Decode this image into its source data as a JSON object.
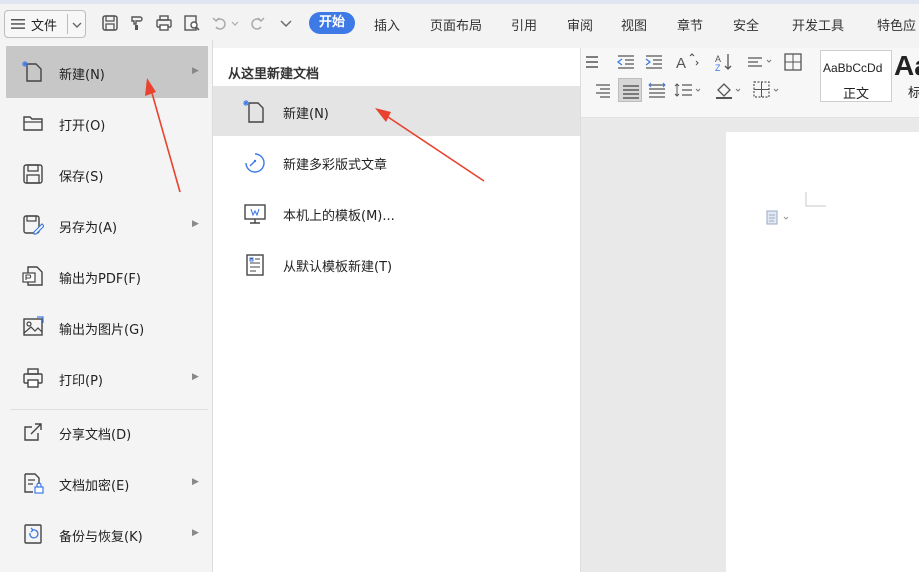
{
  "toolbar": {
    "file_label": "文件",
    "tabs": [
      "开始",
      "插入",
      "页面布局",
      "引用",
      "审阅",
      "视图",
      "章节",
      "安全",
      "开发工具",
      "特色应"
    ]
  },
  "ribbon": {
    "style_sample": "AaBbCcDd",
    "style_name": "正文",
    "style_big_sample": "Aa",
    "style_big_name": "标"
  },
  "file_menu": {
    "items": [
      {
        "label": "新建(N)",
        "icon": "new-doc-icon",
        "has_submenu": true
      },
      {
        "label": "打开(O)",
        "icon": "folder-icon",
        "has_submenu": false
      },
      {
        "label": "保存(S)",
        "icon": "save-icon",
        "has_submenu": false
      },
      {
        "label": "另存为(A)",
        "icon": "save-as-icon",
        "has_submenu": true
      },
      {
        "label": "输出为PDF(F)",
        "icon": "pdf-export-icon",
        "has_submenu": false
      },
      {
        "label": "输出为图片(G)",
        "icon": "image-export-icon",
        "has_submenu": false
      },
      {
        "label": "打印(P)",
        "icon": "print-icon",
        "has_submenu": true
      },
      {
        "label": "分享文档(D)",
        "icon": "share-icon",
        "has_submenu": false
      },
      {
        "label": "文档加密(E)",
        "icon": "encrypt-icon",
        "has_submenu": true
      },
      {
        "label": "备份与恢复(K)",
        "icon": "backup-icon",
        "has_submenu": true
      }
    ]
  },
  "submenu": {
    "header": "从这里新建文档",
    "items": [
      {
        "label": "新建(N)",
        "icon": "new-doc-icon"
      },
      {
        "label": "新建多彩版式文章",
        "icon": "colorful-layout-icon"
      },
      {
        "label": "本机上的模板(M)...",
        "icon": "local-template-icon"
      },
      {
        "label": "从默认模板新建(T)",
        "icon": "default-template-icon"
      }
    ]
  },
  "colors": {
    "accent": "#3d7ae5",
    "annotation_arrow": "#e8432f",
    "selected_item": "#c7c7c7",
    "hover_item": "#e4e4e4"
  }
}
